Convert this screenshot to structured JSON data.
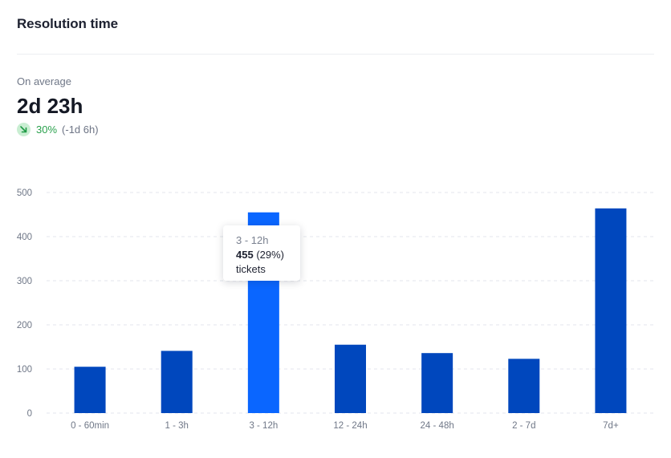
{
  "header": {
    "title": "Resolution time"
  },
  "summary": {
    "label": "On average",
    "value": "2d 23h",
    "trend": {
      "icon": "arrow-down-right-icon",
      "percent": "30%",
      "delta": "(-1d 6h)",
      "color": "#2aa14d"
    }
  },
  "tooltip": {
    "category": "3 - 12h",
    "value": "455",
    "percent": "(29%)",
    "unit": "tickets"
  },
  "colors": {
    "bar": "#0047bd",
    "bar_active": "#0a66ff",
    "grid": "#e3e6ec"
  },
  "chart_data": {
    "type": "bar",
    "categories": [
      "0 - 60min",
      "1 - 3h",
      "3 - 12h",
      "12 - 24h",
      "24 - 48h",
      "2 - 7d",
      "7d+"
    ],
    "values": [
      105,
      141,
      455,
      155,
      136,
      123,
      464
    ],
    "active_index": 2,
    "ylim": [
      0,
      500
    ],
    "yticks": [
      0,
      100,
      200,
      300,
      400,
      500
    ],
    "grid": true,
    "legend": false
  }
}
